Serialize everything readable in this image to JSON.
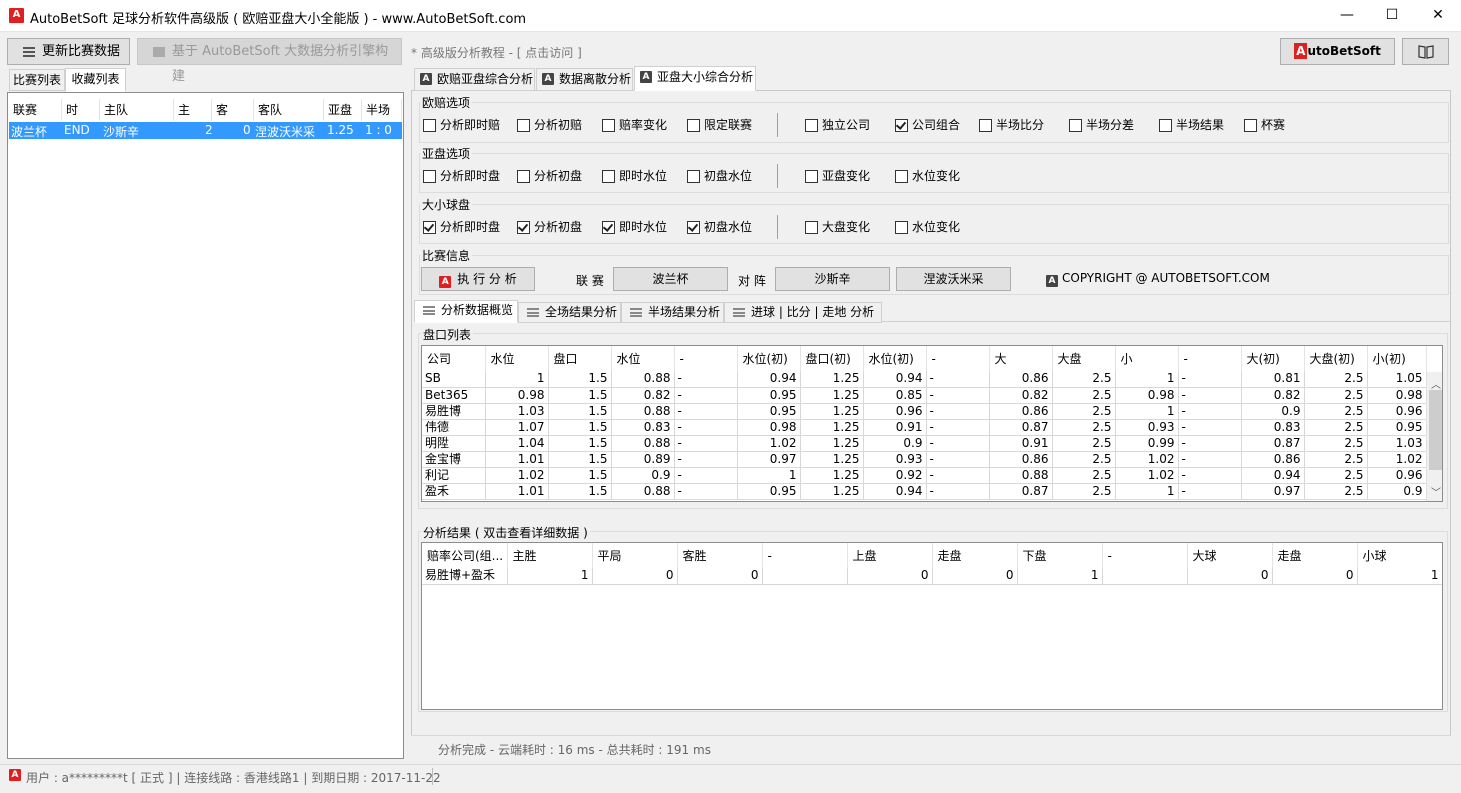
{
  "window": {
    "title": "AutoBetSoft 足球分析软件高级版 ( 欧赔亚盘大小全能版 ) -  www.AutoBetSoft.com",
    "minimize": "—",
    "maximize": "☐",
    "close": "✕"
  },
  "toolbar": {
    "update_label": "更新比赛数据",
    "engine_label": "基于 AutoBetSoft 大数据分析引擎构建",
    "tutorial_label": "* 高级版分析教程 - [ 点击访问 ]",
    "brand_a": "A",
    "brand_rest": "utoBetSoft",
    "book_icon": "book-icon"
  },
  "left": {
    "tabs": [
      "比赛列表",
      "收藏列表"
    ],
    "columns": [
      "联赛",
      "时",
      "主队",
      "主",
      "客",
      "客队",
      "亚盘",
      "半场"
    ],
    "rows": [
      {
        "league": "波兰杯",
        "time": "END",
        "home": "沙斯辛",
        "home_score": "2",
        "away_score": "0",
        "away": "涅波沃米采",
        "handicap": "1.25",
        "half": "1 : 0"
      }
    ]
  },
  "right_tabs": [
    "欧赔亚盘综合分析",
    "数据离散分析",
    "亚盘大小综合分析"
  ],
  "euro_options": {
    "label": "欧赔选项",
    "items": [
      {
        "label": "分析即时赔",
        "checked": false
      },
      {
        "label": "分析初赔",
        "checked": false
      },
      {
        "label": "赔率变化",
        "checked": false
      },
      {
        "label": "限定联赛",
        "checked": false
      },
      {
        "label": "独立公司",
        "checked": false
      },
      {
        "label": "公司组合",
        "checked": true
      },
      {
        "label": "半场比分",
        "checked": false
      },
      {
        "label": "半场分差",
        "checked": false
      },
      {
        "label": "半场结果",
        "checked": false
      },
      {
        "label": "杯赛",
        "checked": false
      }
    ]
  },
  "asian_options": {
    "label": "亚盘选项",
    "items": [
      {
        "label": "分析即时盘",
        "checked": false
      },
      {
        "label": "分析初盘",
        "checked": false
      },
      {
        "label": "即时水位",
        "checked": false
      },
      {
        "label": "初盘水位",
        "checked": false
      },
      {
        "label": "亚盘变化",
        "checked": false
      },
      {
        "label": "水位变化",
        "checked": false
      }
    ]
  },
  "ou_options": {
    "label": "大小球盘",
    "items": [
      {
        "label": "分析即时盘",
        "checked": true
      },
      {
        "label": "分析初盘",
        "checked": true
      },
      {
        "label": "即时水位",
        "checked": true
      },
      {
        "label": "初盘水位",
        "checked": true
      },
      {
        "label": "大盘变化",
        "checked": false
      },
      {
        "label": "水位变化",
        "checked": false
      }
    ]
  },
  "match_info": {
    "label": "比赛信息",
    "run_button": "执 行 分 析",
    "league_label": "联 赛",
    "league_value": "波兰杯",
    "match_label": "对 阵",
    "home": "沙斯辛",
    "away": "涅波沃米采",
    "copyright": "COPYRIGHT @ AUTOBETSOFT.COM"
  },
  "sub_tabs": [
    "分析数据概览",
    "全场结果分析",
    "半场结果分析",
    "进球 | 比分 | 走地 分析"
  ],
  "odds_list": {
    "label": "盘口列表",
    "columns": [
      "公司",
      "水位",
      "盘口",
      "水位",
      "-",
      "水位(初)",
      "盘口(初)",
      "水位(初)",
      "-",
      "大",
      "大盘",
      "小",
      "-",
      "大(初)",
      "大盘(初)",
      "小(初)"
    ],
    "rows": [
      [
        "SB",
        "1",
        "1.5",
        "0.88",
        "-",
        "0.94",
        "1.25",
        "0.94",
        "-",
        "0.86",
        "2.5",
        "1",
        "-",
        "0.81",
        "2.5",
        "1.05"
      ],
      [
        "Bet365",
        "0.98",
        "1.5",
        "0.82",
        "-",
        "0.95",
        "1.25",
        "0.85",
        "-",
        "0.82",
        "2.5",
        "0.98",
        "-",
        "0.82",
        "2.5",
        "0.98"
      ],
      [
        "易胜博",
        "1.03",
        "1.5",
        "0.88",
        "-",
        "0.95",
        "1.25",
        "0.96",
        "-",
        "0.86",
        "2.5",
        "1",
        "-",
        "0.9",
        "2.5",
        "0.96"
      ],
      [
        "伟德",
        "1.07",
        "1.5",
        "0.83",
        "-",
        "0.98",
        "1.25",
        "0.91",
        "-",
        "0.87",
        "2.5",
        "0.93",
        "-",
        "0.83",
        "2.5",
        "0.95"
      ],
      [
        "明陞",
        "1.04",
        "1.5",
        "0.88",
        "-",
        "1.02",
        "1.25",
        "0.9",
        "-",
        "0.91",
        "2.5",
        "0.99",
        "-",
        "0.87",
        "2.5",
        "1.03"
      ],
      [
        "金宝博",
        "1.01",
        "1.5",
        "0.89",
        "-",
        "0.97",
        "1.25",
        "0.93",
        "-",
        "0.86",
        "2.5",
        "1.02",
        "-",
        "0.86",
        "2.5",
        "1.02"
      ],
      [
        "利记",
        "1.02",
        "1.5",
        "0.9",
        "-",
        "1",
        "1.25",
        "0.92",
        "-",
        "0.88",
        "2.5",
        "1.02",
        "-",
        "0.94",
        "2.5",
        "0.96"
      ],
      [
        "盈禾",
        "1.01",
        "1.5",
        "0.88",
        "-",
        "0.95",
        "1.25",
        "0.94",
        "-",
        "0.87",
        "2.5",
        "1",
        "-",
        "0.97",
        "2.5",
        "0.9"
      ]
    ]
  },
  "results": {
    "label": "分析结果 (  双击查看详细数据  )",
    "columns": [
      "赔率公司(组...",
      "主胜",
      "平局",
      "客胜",
      "-",
      "上盘",
      "走盘",
      "下盘",
      "-",
      "大球",
      "走盘",
      "小球"
    ],
    "rows": [
      [
        "易胜博+盈禾",
        "1",
        "0",
        "0",
        "",
        "0",
        "0",
        "1",
        "",
        "0",
        "0",
        "1"
      ]
    ]
  },
  "status": {
    "analysis": "分析完成 -  云端耗时 : 16 ms  - 总共耗时 : 191 ms",
    "user": "用户 : a*********t [ 正式 ] | 连接线路 : 香港线路1 | 到期日期 : 2017-11-22"
  },
  "colors": {
    "accent": "#e02020",
    "selection": "#3399ff"
  }
}
